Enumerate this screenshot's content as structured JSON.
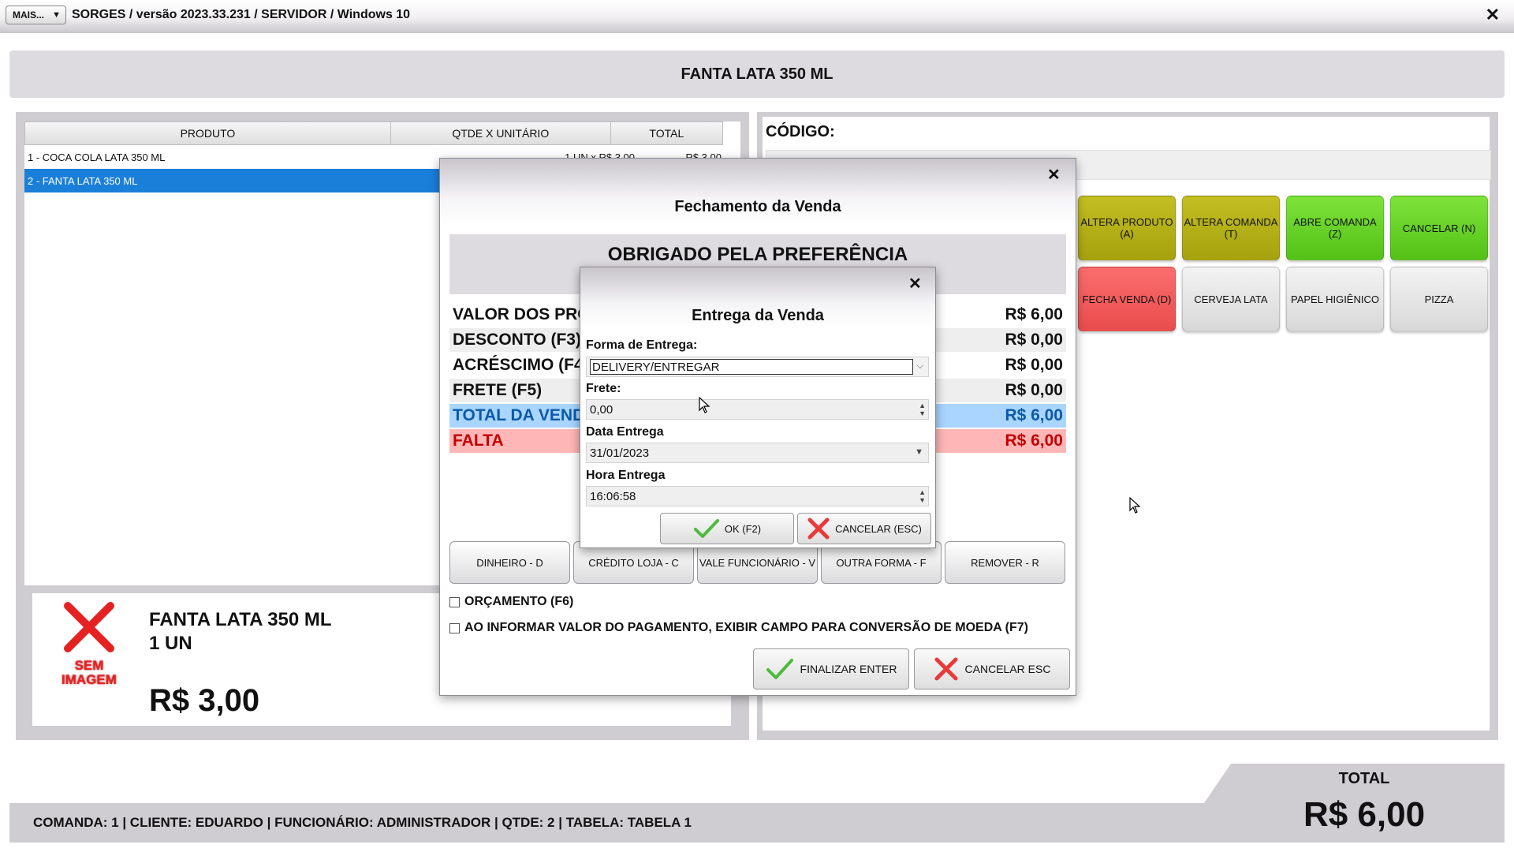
{
  "window": {
    "menu_button": "MAIS...",
    "menu_arrow": "▼",
    "title": "SORGES / versão 2023.33.231 / SERVIDOR / Windows 10",
    "close": "✕"
  },
  "product_header": "FANTA LATA 350 ML",
  "grid": {
    "columns": [
      "PRODUTO",
      "QTDE X UNITÁRIO",
      "TOTAL"
    ],
    "rows": [
      {
        "product": "1 - COCA COLA LATA 350 ML",
        "qty_unit": "1 UN x R$ 3,00",
        "total": "R$ 3,00",
        "selected": false
      },
      {
        "product": "2 - FANTA LATA 350 ML",
        "qty_unit": "",
        "total": "",
        "selected": true
      }
    ]
  },
  "product_card": {
    "no_image_line1": "SEM",
    "no_image_line2": "IMAGEM",
    "name": "FANTA LATA 350 ML",
    "qty": "1  UN",
    "price": "R$ 3,00"
  },
  "codigo_label": "CÓDIGO:",
  "quick_buttons": [
    {
      "label": "ALTERA PRODUTO (A)",
      "color": "#b5b11a"
    },
    {
      "label": "ALTERA COMANDA (T)",
      "color": "#b5b11a"
    },
    {
      "label": "ABRE COMANDA (Z)",
      "color": "#66d024"
    },
    {
      "label": "CANCELAR (N)",
      "color": "#66d024"
    },
    {
      "label": "FECHA VENDA (D)",
      "color": "#f25c5c"
    },
    {
      "label": "CERVEJA LATA",
      "color": "#e6e6e6"
    },
    {
      "label": "PAPEL HIGIÊNICO",
      "color": "#e6e6e6"
    },
    {
      "label": "PIZZA",
      "color": "#e6e6e6"
    }
  ],
  "status_bar": "COMANDA: 1  |  CLIENTE: EDUARDO  |  FUNCIONÁRIO: ADMINISTRADOR  |  QTDE: 2  |  TABELA: TABELA 1",
  "total": {
    "label": "TOTAL",
    "value": "R$ 6,00"
  },
  "fechamento": {
    "close": "✕",
    "title": "Fechamento da Venda",
    "thanks": "OBRIGADO PELA PREFERÊNCIA",
    "rows": [
      {
        "label": "VALOR DOS PRO",
        "value": "R$ 6,00",
        "style": "plain"
      },
      {
        "label": "DESCONTO (F3)",
        "value": "R$ 0,00",
        "style": "light"
      },
      {
        "label": "ACRÉSCIMO (F4",
        "value": "R$ 0,00",
        "style": "plain"
      },
      {
        "label": "FRETE (F5)",
        "value": "R$ 0,00",
        "style": "light"
      },
      {
        "label": "TOTAL DA VEND",
        "value": "R$ 6,00",
        "style": "blue"
      },
      {
        "label": "FALTA",
        "value": "R$ 6,00",
        "style": "pink"
      }
    ],
    "pay_buttons": [
      "DINHEIRO - D",
      "CRÉDITO LOJA - C",
      "VALE FUNCIONÁRIO - V",
      "OUTRA FORMA - F",
      "REMOVER - R"
    ],
    "orcamento": "ORÇAMENTO (F6)",
    "conversao": "AO INFORMAR VALOR DO PAGAMENTO, EXIBIR CAMPO PARA CONVERSÃO DE MOEDA (F7)",
    "finalizar": "FINALIZAR ENTER",
    "cancelar": "CANCELAR ESC"
  },
  "entrega": {
    "close": "✕",
    "title": "Entrega da Venda",
    "forma_label": "Forma de Entrega:",
    "forma_value": "DELIVERY/ENTREGAR",
    "frete_label": "Frete:",
    "frete_value": "0,00",
    "data_label": "Data Entrega",
    "data_value": "31/01/2023",
    "hora_label": "Hora Entrega",
    "hora_value": "16:06:58",
    "ok": "OK (F2)",
    "cancelar": "CANCELAR (ESC)"
  },
  "icons": {
    "check": "check-icon",
    "cross": "cross-icon",
    "no_image": "no-image-icon",
    "cursor": "mouse-cursor-icon"
  }
}
